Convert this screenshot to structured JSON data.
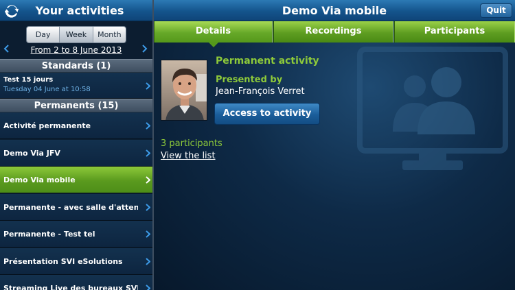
{
  "sidebar": {
    "title": "Your activities",
    "view_modes": [
      "Day",
      "Week",
      "Month"
    ],
    "active_view": "Week",
    "period": "From 2 to 8 June 2013",
    "standards_header": "Standards (1)",
    "standards": [
      {
        "title": "Test 15 jours",
        "subtitle": "Tuesday 04 June at 10:58"
      }
    ],
    "permanents_header": "Permanents (15)",
    "permanents": [
      {
        "label": "Activité permanente"
      },
      {
        "label": "Demo Via JFV"
      },
      {
        "label": "Demo Via mobile"
      },
      {
        "label": "Permanente - avec salle d'attente (..."
      },
      {
        "label": "Permanente - Test tel"
      },
      {
        "label": "Présentation SVI eSolutions"
      },
      {
        "label": "Streaming Live des bureaux SVIeSol..."
      }
    ],
    "selected_index": 2
  },
  "header": {
    "title": "Demo Via mobile",
    "quit_label": "Quit"
  },
  "tabs": [
    {
      "label": "Details"
    },
    {
      "label": "Recordings"
    },
    {
      "label": "Participants"
    }
  ],
  "details": {
    "activity_type": "Permanent activity",
    "presented_by_label": "Presented by",
    "presenter": "Jean-François Verret",
    "access_button": "Access to activity",
    "participants_count": "3 participants",
    "view_list": "View the list"
  },
  "colors": {
    "accent_green": "#8dc93a",
    "header_blue": "#14548c",
    "link_blue": "#6fb2e6"
  }
}
